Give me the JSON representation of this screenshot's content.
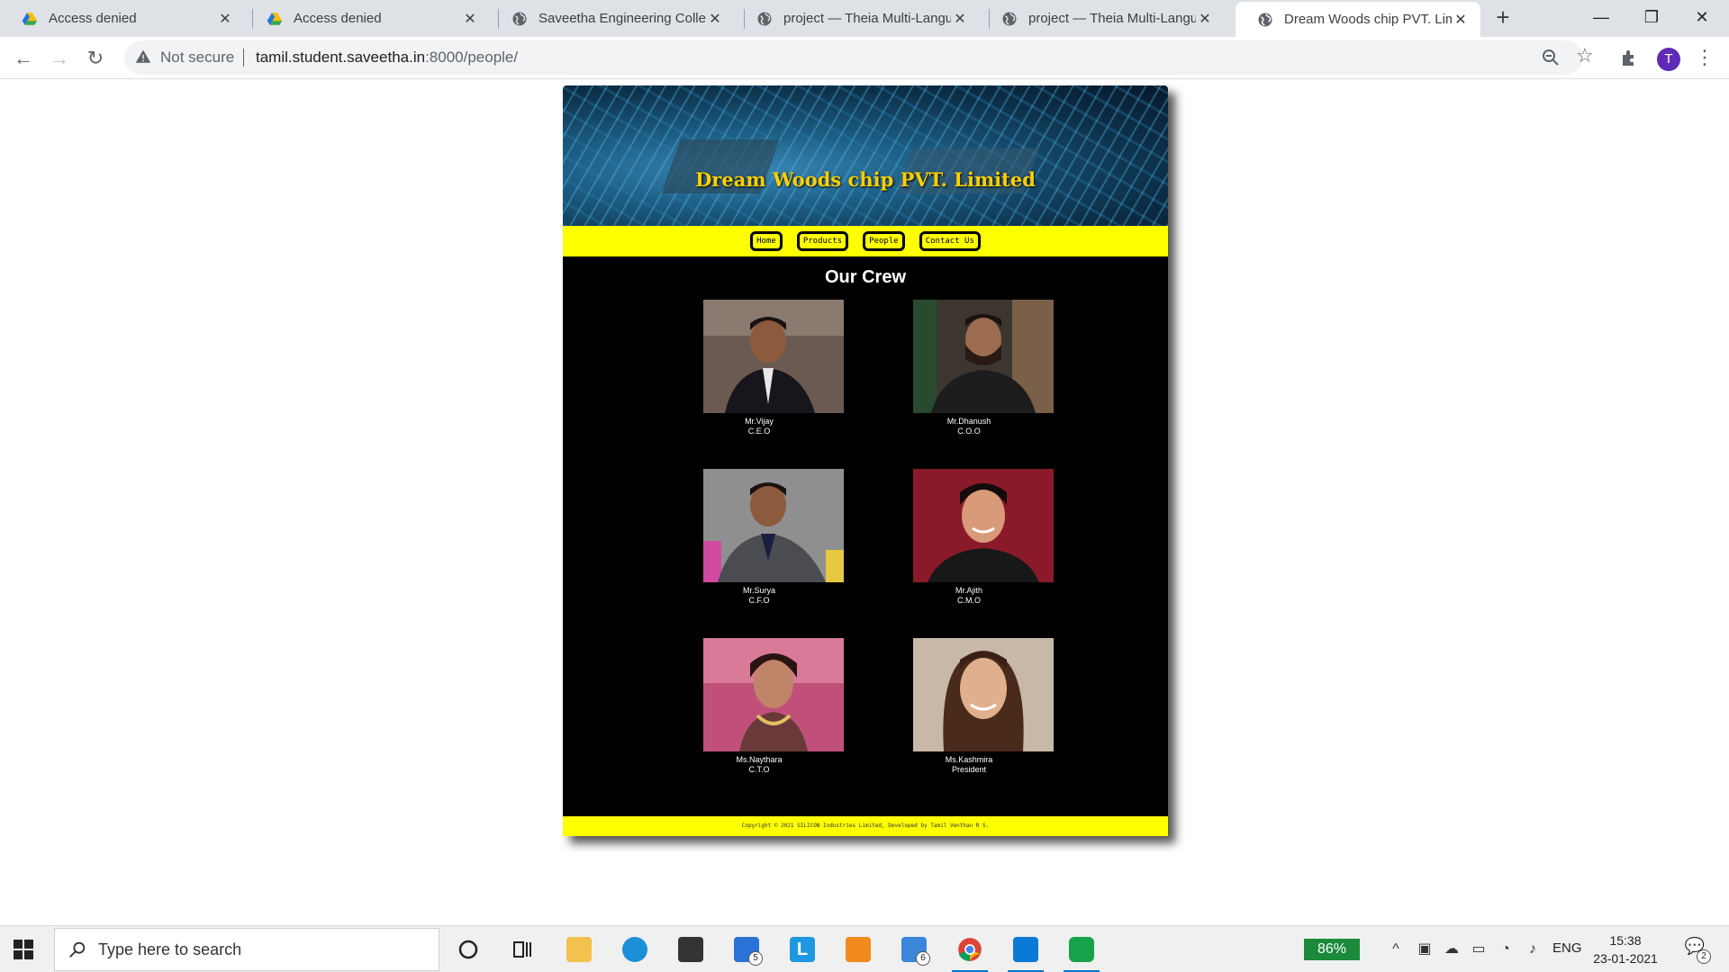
{
  "browser": {
    "tabs": [
      {
        "title": "Access denied",
        "icon": "google-drive-icon"
      },
      {
        "title": "Access denied",
        "icon": "google-drive-icon"
      },
      {
        "title": "Saveetha Engineering College",
        "icon": "globe-icon"
      },
      {
        "title": "project — Theia Multi-Language",
        "icon": "globe-icon"
      },
      {
        "title": "project — Theia Multi-Language",
        "icon": "globe-icon"
      },
      {
        "title": "Dream Woods chip PVT. Limited",
        "icon": "globe-icon"
      }
    ],
    "active_tab": 5,
    "security_label": "Not secure",
    "url_host": "tamil.student.saveetha.in",
    "url_rest": ":8000/people/",
    "profile_initial": "T"
  },
  "site": {
    "title": "Dream Woods chip PVT. Limited",
    "nav": [
      {
        "label": "Home"
      },
      {
        "label": "Products"
      },
      {
        "label": "People"
      },
      {
        "label": "Contact Us"
      }
    ],
    "heading": "Our Crew",
    "crew": [
      {
        "name": "Mr.Vijay",
        "role": "C.E.O"
      },
      {
        "name": "Mr.Dhanush",
        "role": "C.O.O"
      },
      {
        "name": "Mr.Surya",
        "role": "C.F.O"
      },
      {
        "name": "Mr.Ajith",
        "role": "C.M.O"
      },
      {
        "name": "Ms.Naythara",
        "role": "C.T.O"
      },
      {
        "name": "Ms.Kashmira",
        "role": "President"
      }
    ],
    "footer": "Copyright © 2021 SILICON Industries Limited, Developed by Tamil Venthan R S."
  },
  "taskbar": {
    "search_placeholder": "Type here to search",
    "mail_badge": "5",
    "files_badge": "6",
    "battery": "86%",
    "language": "ENG",
    "time": "15:38",
    "date": "23-01-2021",
    "notifications": "2"
  },
  "colors": {
    "nav_bar": "#ffff00",
    "title_text": "#ffd000",
    "main_bg": "#000000"
  }
}
